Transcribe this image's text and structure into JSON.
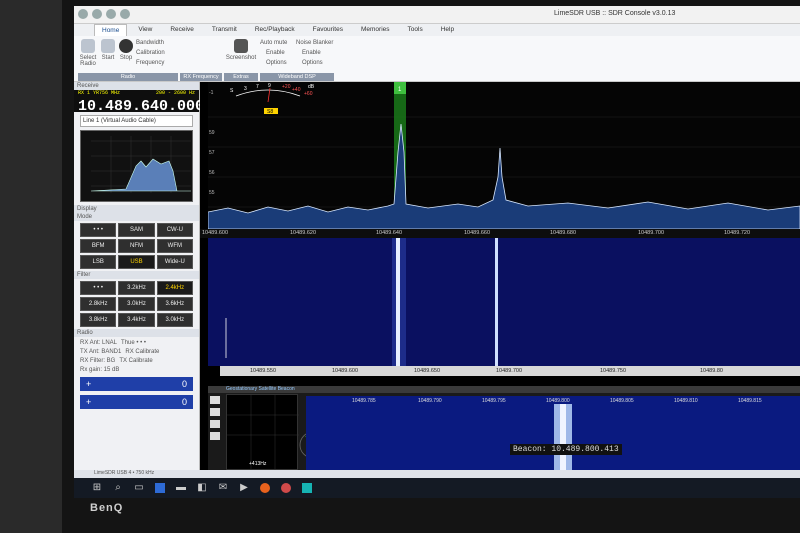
{
  "window": {
    "title": "LimeSDR USB :: SDR Console v3.0.13"
  },
  "tabs": [
    "Home",
    "View",
    "Receive",
    "Transmit",
    "Rec/Playback",
    "Favourites",
    "Memories",
    "Tools",
    "Help"
  ],
  "ribbon": {
    "select": "Select Radio",
    "start": "Start",
    "stop": "Stop",
    "bandwidth": "Bandwidth",
    "calibration": "Calibration",
    "frequency": "Frequency",
    "screenshot": "Screenshot",
    "auto_mute": "Auto mute",
    "noise_blanker": "Noise Blanker",
    "enable1": "Enable",
    "enable2": "Enable",
    "options1": "Options",
    "options2": "Options",
    "groups": [
      "Radio",
      "RX Frequency",
      "Extras",
      "Wideband DSP"
    ]
  },
  "receive": {
    "header": "Receive",
    "sub_label": "RX 1  YR756 MHz",
    "range": "200 - 2600 Hz",
    "frequency": "10.489.640.000",
    "output": "Line 1 (Virtual Audio Cable)"
  },
  "display_header": "Display",
  "mode": {
    "header": "Mode",
    "buttons": [
      "• • •",
      "SAM",
      "CW-U",
      "BFM",
      "NFM",
      "WFM",
      "LSB",
      "USB",
      "Wide-U"
    ],
    "active": "USB"
  },
  "filter": {
    "header": "Filter",
    "buttons": [
      "• • •",
      "3.2kHz",
      "2.4kHz",
      "2.8kHz",
      "3.0kHz",
      "3.6kHz",
      "3.8kHz",
      "3.4kHz",
      "3.0kHz"
    ],
    "active": "2.4kHz"
  },
  "radio": {
    "header": "Radio",
    "rows": [
      "RX Ant: LNAL",
      "TX Ant: BAND1",
      "RX Filter: BG",
      "Rx gain: 15 dB"
    ],
    "right": [
      "Thue • • •",
      "RX Calibrate",
      "TX Calibrate"
    ],
    "slider1": [
      "+",
      "0"
    ],
    "slider2": [
      "+",
      "0"
    ]
  },
  "smeter": {
    "labels": [
      "S",
      "1",
      "3",
      "5",
      "7",
      "9",
      "+20",
      "+40",
      "+60"
    ],
    "db": "dB",
    "value": "S8"
  },
  "spectrum": {
    "ylabels": [
      "-1",
      "59",
      "57",
      "56",
      "55"
    ]
  },
  "scale_labels": [
    "10489.600",
    "10489.620",
    "10489.640",
    "10489.660",
    "10489.680",
    "10489.700",
    "10489.720"
  ],
  "zoom_labels": [
    "10489.550",
    "10489.600",
    "10489.650",
    "10489.700",
    "10489.750",
    "10489.80"
  ],
  "lower": {
    "header": "Geostationary Satellite Beacon",
    "scale": [
      "10489.785",
      "10489.790",
      "10489.795",
      "10489.800",
      "10489.805",
      "10489.810",
      "10489.815"
    ],
    "offset": "+413Hz",
    "beacon": "Beacon: 10.489.800.413"
  },
  "status": "LimeSDR USB 4 • 750 kHz",
  "monitor_brand": "BenQ",
  "colors": {
    "signal": "#7fb2ff",
    "passband": "#3fbf3f",
    "waterfall": "#0a1060",
    "accent": "#ffd400"
  }
}
